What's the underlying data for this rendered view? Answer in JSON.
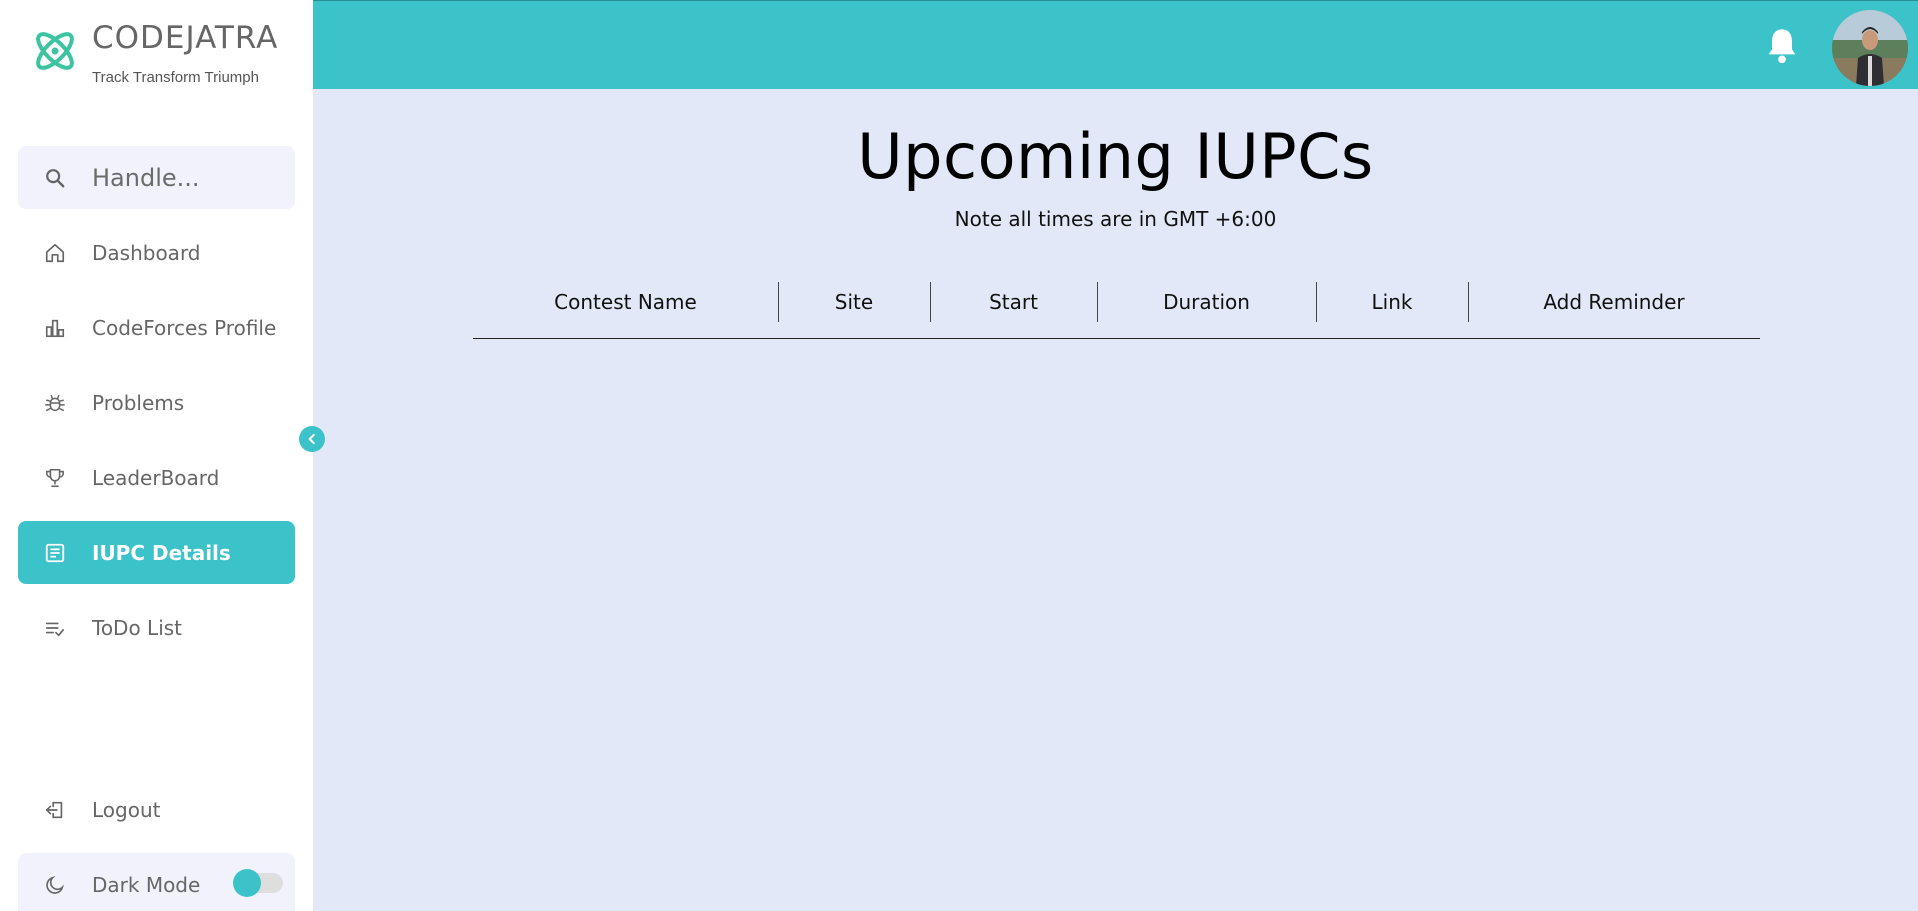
{
  "brand": {
    "name": "CODEJATRA",
    "tagline": "Track Transform Triumph",
    "accent_color": "#3cc3c9"
  },
  "search": {
    "placeholder": "Handle..."
  },
  "sidebar": {
    "items": [
      {
        "label": "Dashboard",
        "icon": "home-icon"
      },
      {
        "label": "CodeForces Profile",
        "icon": "bar-chart-icon"
      },
      {
        "label": "Problems",
        "icon": "bug-icon"
      },
      {
        "label": "LeaderBoard",
        "icon": "trophy-icon"
      },
      {
        "label": "IUPC Details",
        "icon": "document-icon",
        "active": true
      },
      {
        "label": "ToDo List",
        "icon": "checklist-icon"
      }
    ],
    "logout_label": "Logout",
    "dark_mode_label": "Dark Mode"
  },
  "main": {
    "title": "Upcoming IUPCs",
    "note": "Note all times are in GMT +6:00",
    "table_headers": [
      "Contest Name",
      "Site",
      "Start",
      "Duration",
      "Link",
      "Add Reminder"
    ]
  }
}
